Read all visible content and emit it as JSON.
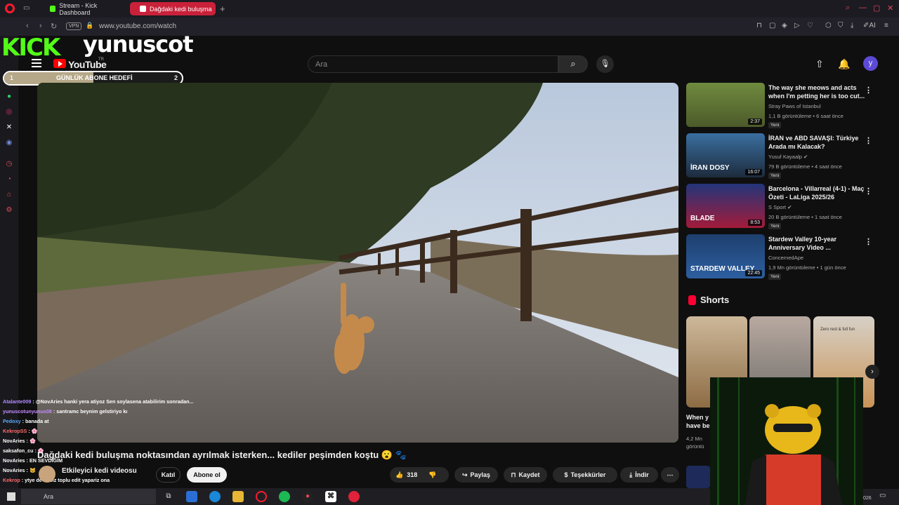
{
  "browser": {
    "tabs": [
      {
        "label": "Stream - Kick Dashboard",
        "icon": "kick-icon"
      },
      {
        "label": "Dağdaki kedi buluşma",
        "icon": "speaker-icon"
      }
    ],
    "vpn_label": "VPN",
    "url": "www.youtube.com/watch",
    "ai_label": "AI"
  },
  "overlay": {
    "kick_logo": "KICK",
    "streamer": "yunuscot",
    "goal_label": "GÜNLÜK ABONE HEDEFİ",
    "goal_current": "1",
    "goal_target": "2",
    "goal_progress": 0.5
  },
  "header": {
    "logo_text": "YouTube",
    "region": "TR",
    "search_placeholder": "Ara",
    "avatar_letter": "y"
  },
  "video": {
    "title": "Dağdaki kedi buluşma noktasından ayrılmak isterken... kediler peşimden koştu 😮 🐾",
    "channel": "Etkileyici kedi videosu",
    "join_label": "Katıl",
    "subscribe_label": "Abone ol",
    "likes": "318",
    "share_label": "Paylaş",
    "save_label": "Kaydet",
    "thanks_label": "Teşekkürler",
    "download_label": "İndir"
  },
  "chat": [
    {
      "user": "Atalante009",
      "msg": ": @NovAries hanki yera atiyoz Sen soylasena atabilirim sonradan...",
      "color": "#b18cff"
    },
    {
      "user": "yunuscotunyunus08",
      "msg": ": santramc beynim gelstiriyo kı",
      "color": "#c48bff"
    },
    {
      "user": "Pedoxy",
      "msg": ": banada at",
      "color": "#5aa9ff"
    },
    {
      "user": "KekropSS",
      "msg": ": 🌸",
      "color": "#ff6b6b"
    },
    {
      "user": "NovAries",
      "msg": ": 🌸",
      "color": "#ffffff"
    },
    {
      "user": "saksafon_cu",
      "msg": ": 🌸",
      "color": "#ffffff"
    },
    {
      "user": "NovAries",
      "msg": ": EN SEVDİĞİM",
      "color": "#ffffff"
    },
    {
      "user": "NovAries",
      "msg": ": 🐱",
      "color": "#ffffff"
    },
    {
      "user": "Kekrop",
      "msg": ": ytye de at biz toplu edit yapariz ona",
      "color": "#ff6b6b"
    }
  ],
  "recommendations": [
    {
      "title": "The way she meows and acts when I'm petting her is too cut...",
      "channel": "Stray Paws of Istanbul",
      "meta": "1,1 B görüntüleme • 6 saat önce",
      "duration": "2:37",
      "badge": "Yeni",
      "verified": false
    },
    {
      "title": "İRAN ve ABD SAVAŞI: Türkiye Arada mı Kalacak?",
      "channel": "Yusuf Kayaalp",
      "meta": "79 B görüntüleme • 4 saat önce",
      "duration": "16:07",
      "badge": "Yeni",
      "verified": true,
      "thumb_text": "İRAN DOSY"
    },
    {
      "title": "Barcelona - Villarreal (4-1) - Maç Özeti - LaLiga 2025/26",
      "channel": "S Sport",
      "meta": "20 B görüntüleme • 1 saat önce",
      "duration": "8:53",
      "badge": "Yeni",
      "verified": true,
      "thumb_text": "BLADE"
    },
    {
      "title": "Stardew Valley 10-year Anniversary Video ...",
      "channel": "ConcernedApe",
      "meta": "1,9 Mn görüntüleme • 1 gün önce",
      "duration": "22:45",
      "badge": "Yeni",
      "verified": false,
      "thumb_text": "STARDEW VALLEY"
    }
  ],
  "shorts": {
    "heading": "Shorts",
    "partial_title": "When y have be",
    "partial_meta": "4,2 Mn görüntü",
    "thumb3_text": "Zero rest & full fun"
  },
  "taskbar": {
    "search_label": "Ara",
    "clock": "026"
  },
  "colors": {
    "accent": "#ff0000",
    "kick_green": "#53fc18",
    "tab_active": "#c9213a"
  }
}
